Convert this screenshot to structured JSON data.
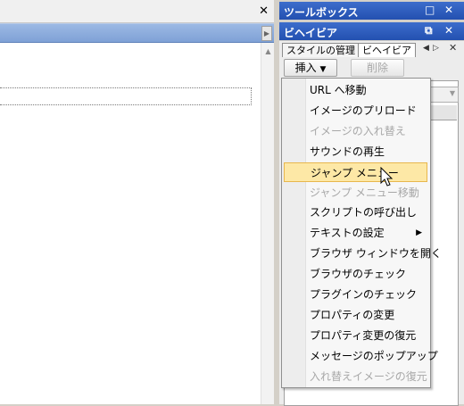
{
  "toolbox": {
    "title": "ツールボックス"
  },
  "behavior_panel": {
    "title": "ビヘイビア",
    "tabs": [
      "スタイルの管理",
      "ビヘイビア"
    ],
    "insert_label": "挿入",
    "delete_label": "削除"
  },
  "menu": {
    "items": [
      {
        "label": "URL へ移動",
        "disabled": false
      },
      {
        "label": "イメージのプリロード",
        "disabled": false
      },
      {
        "label": "イメージの入れ替え",
        "disabled": true
      },
      {
        "label": "サウンドの再生",
        "disabled": false
      },
      {
        "label": "ジャンプ メニュー",
        "disabled": false,
        "highlighted": true
      },
      {
        "label": "ジャンプ メニュー移動",
        "disabled": true
      },
      {
        "label": "スクリプトの呼び出し",
        "disabled": false
      },
      {
        "label": "テキストの設定",
        "disabled": false,
        "submenu": true
      },
      {
        "label": "ブラウザ ウィンドウを開く",
        "disabled": false
      },
      {
        "label": "ブラウザのチェック",
        "disabled": false
      },
      {
        "label": "プラグインのチェック",
        "disabled": false
      },
      {
        "label": "プロパティの変更",
        "disabled": false
      },
      {
        "label": "プロパティ変更の復元",
        "disabled": false
      },
      {
        "label": "メッセージのポップアップ",
        "disabled": false
      },
      {
        "label": "入れ替えイメージの復元",
        "disabled": true
      }
    ]
  },
  "colors": {
    "title_bar": "#2350b0",
    "highlight": "#fde8a6",
    "highlight_border": "#e8b74d"
  }
}
